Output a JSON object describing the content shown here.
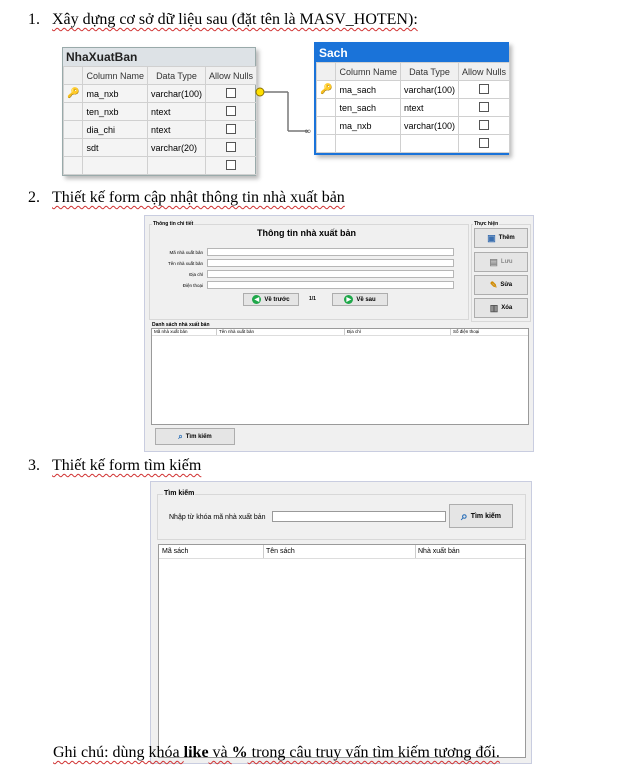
{
  "sections": [
    {
      "num": "1.",
      "text": "Xây dựng cơ sở dữ liệu sau (đặt tên là MASV_HOTEN):"
    },
    {
      "num": "2.",
      "text": "Thiết kế form cập nhật thông tin nhà xuất bản"
    },
    {
      "num": "3.",
      "text": "Thiết kế form tìm kiếm"
    }
  ],
  "db_headers": [
    "Column Name",
    "Data Type",
    "Allow Nulls"
  ],
  "tables": [
    {
      "name": "NhaXuatBan",
      "rows": [
        {
          "key": true,
          "name": "ma_nxb",
          "type": "varchar(100)"
        },
        {
          "key": false,
          "name": "ten_nxb",
          "type": "ntext"
        },
        {
          "key": false,
          "name": "dia_chi",
          "type": "ntext"
        },
        {
          "key": false,
          "name": "sdt",
          "type": "varchar(20)"
        },
        {
          "key": false,
          "name": "",
          "type": ""
        }
      ]
    },
    {
      "name": "Sach",
      "rows": [
        {
          "key": true,
          "name": "ma_sach",
          "type": "varchar(100)"
        },
        {
          "key": false,
          "name": "ten_sach",
          "type": "ntext"
        },
        {
          "key": false,
          "name": "ma_nxb",
          "type": "varchar(100)"
        },
        {
          "key": false,
          "name": "",
          "type": ""
        }
      ]
    }
  ],
  "form_update": {
    "group_detail": "Thông tin chi tiết",
    "title": "Thông tin nhà xuất bản",
    "labels": [
      "Mã nhà xuất bản",
      "Tên nhà xuất bản",
      "Địa chỉ",
      "Điện thoại"
    ],
    "prev": "Về trước",
    "page": "1/1",
    "next": "Về sau",
    "group_actions": "Thực hiện",
    "btn_add": "Thêm",
    "btn_save": "Lưu",
    "btn_edit": "Sửa",
    "btn_delete": "Xóa",
    "list_title": "Danh sách nhà xuất bản",
    "columns": [
      "Mã nhà xuất bản",
      "Tên nhà xuất bản",
      "Địa chỉ",
      "Số điện thoại"
    ],
    "btn_search": "Tìm kiếm"
  },
  "form_search": {
    "group": "Tìm kiếm",
    "prompt": "Nhập từ khóa mã nhà xuất bản",
    "input_value": "",
    "btn_search": "Tìm kiếm",
    "columns": [
      "Mã sách",
      "Tên sách",
      "Nhà xuất bản"
    ]
  },
  "note": {
    "pre": "Ghi chú: dùng khóa ",
    "kw1": "like",
    "mid": " và ",
    "kw2": "%",
    "post": " trong câu truy vấn tìm kiếm tương đối."
  },
  "colors": {
    "key": "#c8a000",
    "sach_header": "#1a73d9",
    "green": "#1fa84a"
  }
}
